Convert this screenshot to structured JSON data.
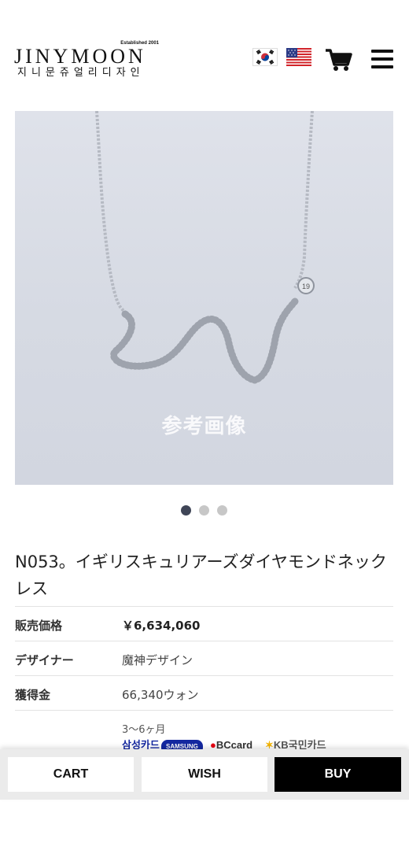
{
  "header": {
    "logo_established": "Established 2001",
    "logo_main": "JINYMOON",
    "logo_sub": "지니문쥬얼리디자인",
    "flags": [
      "korean-flag",
      "us-flag"
    ],
    "cart_icon": "shopping-cart-icon",
    "menu_icon": "hamburger-menu-icon"
  },
  "product": {
    "image_watermark": "参考画像",
    "carousel": {
      "total": 3,
      "active": 1
    },
    "title": "N053。イギリスキュリアーズダイヤモンドネックレス",
    "rows": [
      {
        "label": "販売価格",
        "value": "￥6,634,060"
      },
      {
        "label": "デザイナー",
        "value": "魔神デザイン"
      },
      {
        "label": "獲得金",
        "value": "66,340ウォン"
      }
    ],
    "installment": "3〜6ヶ月",
    "card_brands": [
      "삼성카드",
      "SAMSUNG",
      "BCcard",
      "KB국민카드"
    ]
  },
  "bottom_bar": {
    "cart_label": "CART",
    "wish_label": "WISH",
    "buy_label": "BUY"
  },
  "colors": {
    "accent_dark": "#000000",
    "dot_active": "#3f4557",
    "dot_inactive": "#c7c7c7",
    "kb_yellow": "#f4b400",
    "bc_red": "#e60012",
    "samsung_blue": "#1428a0"
  }
}
